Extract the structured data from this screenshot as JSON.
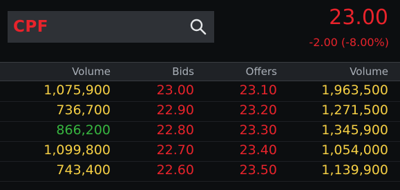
{
  "quote": {
    "symbol": "CPF",
    "price": "23.00",
    "change": "-2.00 (-8.00%)"
  },
  "colors": {
    "accent_red": "#e8232b",
    "volume_yellow": "#f5cf44",
    "volume_green": "#37b53f",
    "background": "#0c0e10",
    "header_bg": "#1f2226",
    "search_bg": "#2e3136"
  },
  "icons": {
    "search": "search-icon"
  },
  "table": {
    "headers": {
      "bid_volume": "Volume",
      "bids": "Bids",
      "offers": "Offers",
      "offer_volume": "Volume"
    },
    "rows": [
      {
        "bid_volume": "1,075,900",
        "bid": "23.00",
        "offer": "23.10",
        "offer_volume": "1,963,500"
      },
      {
        "bid_volume": "736,700",
        "bid": "22.90",
        "offer": "23.20",
        "offer_volume": "1,271,500"
      },
      {
        "bid_volume": "866,200",
        "bid": "22.80",
        "offer": "23.30",
        "offer_volume": "1,345,900"
      },
      {
        "bid_volume": "1,099,800",
        "bid": "22.70",
        "offer": "23.40",
        "offer_volume": "1,054,000"
      },
      {
        "bid_volume": "743,400",
        "bid": "22.60",
        "offer": "23.50",
        "offer_volume": "1,139,900"
      }
    ]
  }
}
